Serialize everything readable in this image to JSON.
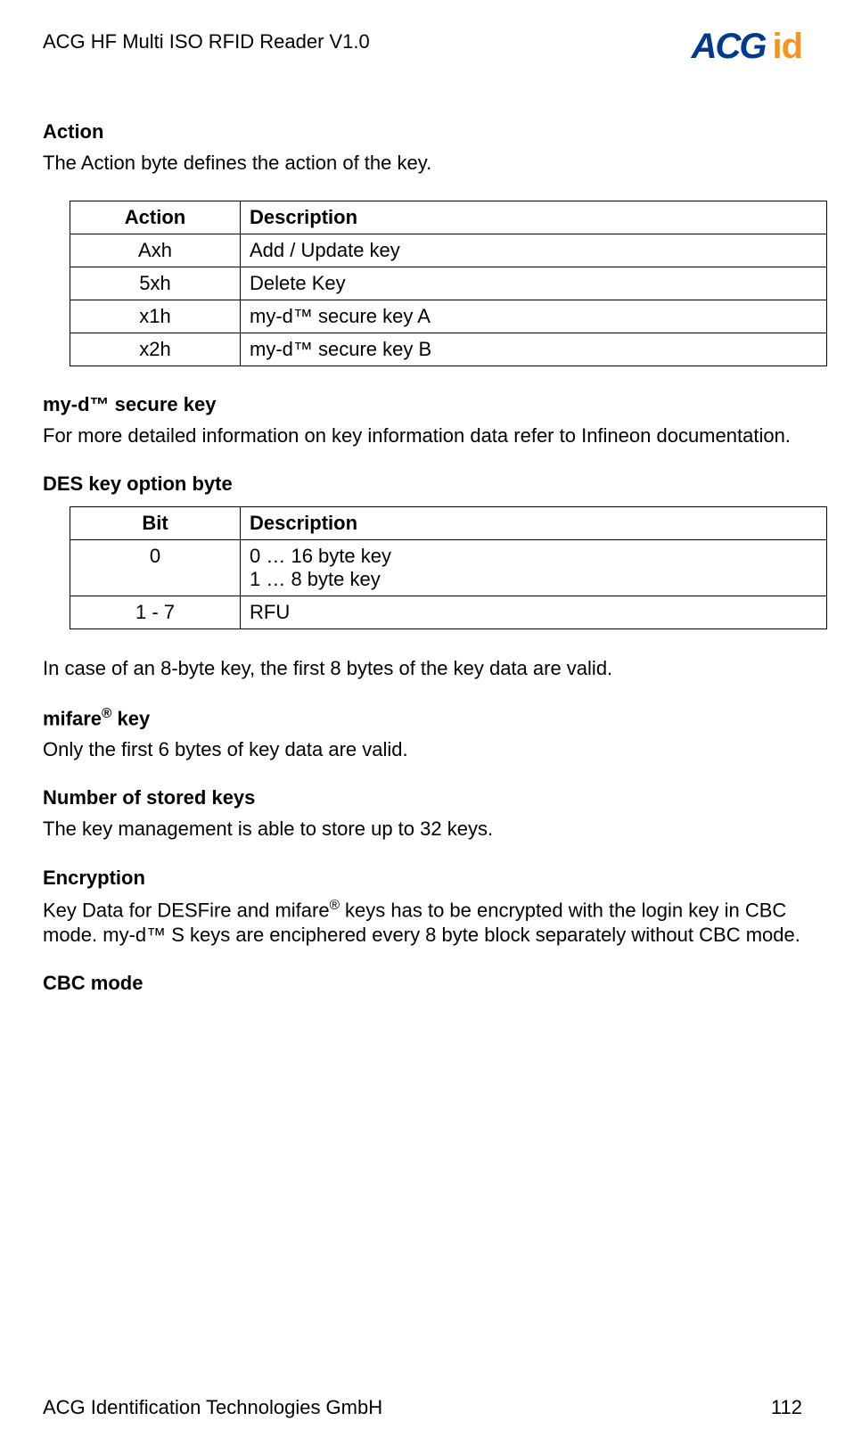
{
  "header": {
    "title": "ACG HF Multi ISO RFID Reader V1.0",
    "logo_text1": "ACG",
    "logo_text2": "id"
  },
  "sections": {
    "action_heading": "Action",
    "action_para": "The Action byte defines the action of the key.",
    "myd_heading": "my-d™ secure key",
    "myd_para": "For more detailed information on key information data refer to Infineon documentation.",
    "des_heading": "DES key option byte",
    "des_para_after": "In case of an 8-byte key, the first 8 bytes of the key data are valid.",
    "mifare_heading_pre": "mifare",
    "mifare_heading_sup": "®",
    "mifare_heading_post": " key",
    "mifare_para": "Only the first 6 bytes of key data are valid.",
    "num_heading": "Number of stored keys",
    "num_para": "The key management is able to store up to 32 keys.",
    "enc_heading": "Encryption",
    "enc_para_1": "Key Data for DESFire and mifare",
    "enc_para_sup": "®",
    "enc_para_2": " keys has to be encrypted with the login key in CBC mode. my-d™ S keys are enciphered every 8 byte block separately without CBC mode.",
    "cbc_heading": "CBC mode"
  },
  "table1": {
    "h1": "Action",
    "h2": "Description",
    "rows": [
      {
        "c1": "Axh",
        "c2": "Add / Update key"
      },
      {
        "c1": "5xh",
        "c2": "Delete Key"
      },
      {
        "c1": "x1h",
        "c2": "my-d™ secure key A"
      },
      {
        "c1": "x2h",
        "c2": "my-d™ secure key B"
      }
    ]
  },
  "table2": {
    "h1": "Bit",
    "h2": "Description",
    "rows": [
      {
        "c1": "0",
        "c2": "0 … 16 byte key\n1 … 8 byte key"
      },
      {
        "c1": "1 - 7",
        "c2": "RFU"
      }
    ]
  },
  "footer": {
    "left": "ACG Identification Technologies GmbH",
    "right": "112"
  }
}
